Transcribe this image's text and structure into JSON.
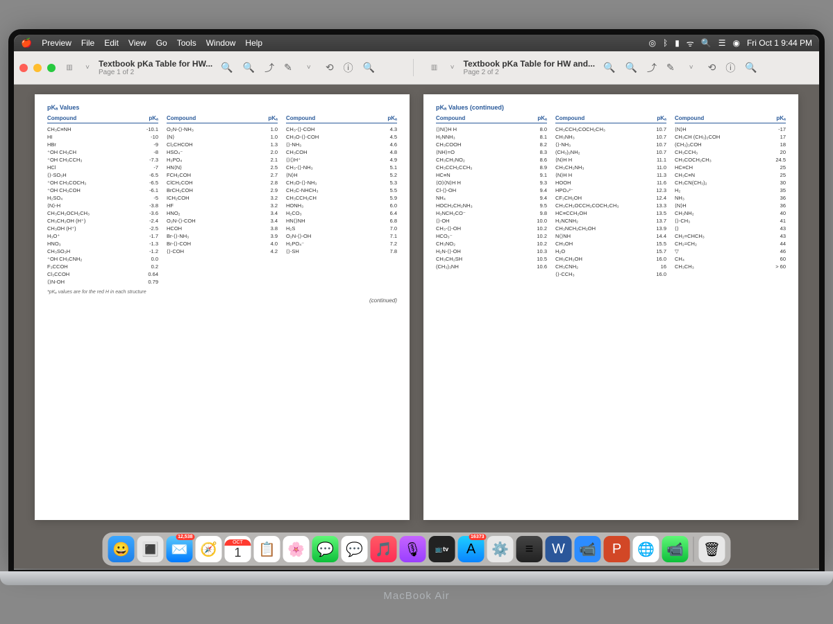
{
  "menubar": {
    "app": "Preview",
    "items": [
      "File",
      "Edit",
      "View",
      "Go",
      "Tools",
      "Window",
      "Help"
    ],
    "clock": "Fri Oct 1 9:44 PM"
  },
  "window": {
    "tabs": [
      {
        "title": "Textbook pKa Table for HW...",
        "subtitle": "Page 1 of 2"
      },
      {
        "title": "Textbook pKa Table for HW and...",
        "subtitle": "Page 2 of 2"
      }
    ]
  },
  "page1": {
    "header": "pKₐ Values",
    "col_hdr": [
      "Compound",
      "pKₐ"
    ],
    "footnote": "*pKₐ values are for the red H in each structure",
    "continued": "(continued)",
    "cols": [
      [
        {
          "c": "CH₃C≡NH",
          "p": "-10.1"
        },
        {
          "c": "HI",
          "p": "-10"
        },
        {
          "c": "HBr",
          "p": "-9"
        },
        {
          "c": "⁺OH CH₃CH",
          "p": "-8"
        },
        {
          "c": "⁺OH CH₃CCH₃",
          "p": "-7.3"
        },
        {
          "c": "HCl",
          "p": "-7"
        },
        {
          "c": "⟨⟩-SO₃H",
          "p": "-6.5"
        },
        {
          "c": "⁺OH CH₃COCH₃",
          "p": "-6.5"
        },
        {
          "c": "⁺OH CH₃COH",
          "p": "-6.1"
        },
        {
          "c": "H₂SO₄",
          "p": "-5"
        },
        {
          "c": "⟨N⟩-H",
          "p": "-3.8"
        },
        {
          "c": "CH₃CH₂OCH₂CH₃",
          "p": "-3.6"
        },
        {
          "c": "CH₃CH₂OH (H⁺)",
          "p": "-2.4"
        },
        {
          "c": "CH₃OH (H⁺)",
          "p": "-2.5"
        },
        {
          "c": "H₃O⁺",
          "p": "-1.7"
        },
        {
          "c": "HNO₃",
          "p": "-1.3"
        },
        {
          "c": "CH₃SO₃H",
          "p": "-1.2"
        },
        {
          "c": "⁺OH CH₃CNH₂",
          "p": "0.0"
        },
        {
          "c": "F₃CCOH",
          "p": "0.2"
        },
        {
          "c": "Cl₃CCOH",
          "p": "0.64"
        },
        {
          "c": "⟨⟩N-OH",
          "p": "0.79"
        }
      ],
      [
        {
          "c": "O₂N-⟨⟩-NH₃",
          "p": "1.0"
        },
        {
          "c": "⟨N⟩",
          "p": "1.0"
        },
        {
          "c": "Cl₂CHCOH",
          "p": "1.3"
        },
        {
          "c": "HSO₄⁻",
          "p": "2.0"
        },
        {
          "c": "H₃PO₄",
          "p": "2.1"
        },
        {
          "c": "HN⟨N⟩",
          "p": "2.5"
        },
        {
          "c": "FCH₂COH",
          "p": "2.7"
        },
        {
          "c": "ClCH₂COH",
          "p": "2.8"
        },
        {
          "c": "BrCH₂COH",
          "p": "2.9"
        },
        {
          "c": "ICH₂COH",
          "p": "3.2"
        },
        {
          "c": "HF",
          "p": "3.2"
        },
        {
          "c": "HNO₂",
          "p": "3.4"
        },
        {
          "c": "O₂N-⟨⟩-COH",
          "p": "3.4"
        },
        {
          "c": "HCOH",
          "p": "3.8"
        },
        {
          "c": "Br-⟨⟩-NH₃",
          "p": "3.9"
        },
        {
          "c": "Br-⟨⟩-COH",
          "p": "4.0"
        },
        {
          "c": "⟨⟩-COH",
          "p": "4.2"
        }
      ],
      [
        {
          "c": "CH₃-⟨⟩-COH",
          "p": "4.3"
        },
        {
          "c": "CH₃O-⟨⟩-COH",
          "p": "4.5"
        },
        {
          "c": "⟨⟩-NH₃",
          "p": "4.6"
        },
        {
          "c": "CH₃COH",
          "p": "4.8"
        },
        {
          "c": "⟨⟩⟨⟩H⁺",
          "p": "4.9"
        },
        {
          "c": "CH₃-⟨⟩-NH₃",
          "p": "5.1"
        },
        {
          "c": "⟨N⟩H",
          "p": "5.2"
        },
        {
          "c": "CH₃O-⟨⟩-NH₃",
          "p": "5.3"
        },
        {
          "c": "CH₃C-NHCH₃",
          "p": "5.5"
        },
        {
          "c": "CH₃CCH₂CH",
          "p": "5.9"
        },
        {
          "c": "HONH₃",
          "p": "6.0"
        },
        {
          "c": "H₂CO₃",
          "p": "6.4"
        },
        {
          "c": "HN⟨⟩NH",
          "p": "6.8"
        },
        {
          "c": "H₂S",
          "p": "7.0"
        },
        {
          "c": "O₂N-⟨⟩-OH",
          "p": "7.1"
        },
        {
          "c": "H₂PO₄⁻",
          "p": "7.2"
        },
        {
          "c": "⟨⟩-SH",
          "p": "7.8"
        }
      ]
    ]
  },
  "page2": {
    "header": "pKₐ Values (continued)",
    "col_hdr": [
      "Compound",
      "pKₐ"
    ],
    "cols": [
      [
        {
          "c": "⟨⟩N⟨⟩H H",
          "p": "8.0"
        },
        {
          "c": "H₂NNH₃",
          "p": "8.1"
        },
        {
          "c": "CH₃COOH",
          "p": "8.2"
        },
        {
          "c": "⟨NH⟩=O",
          "p": "8.3"
        },
        {
          "c": "CH₃CH₂NO₂",
          "p": "8.6"
        },
        {
          "c": "CH₃CCH₂CCH₃",
          "p": "8.9"
        },
        {
          "c": "HC≡N",
          "p": "9.1"
        },
        {
          "c": "⟨O⟩⟨N⟩H H",
          "p": "9.3"
        },
        {
          "c": "Cl-⟨⟩-OH",
          "p": "9.4"
        },
        {
          "c": "NH₄",
          "p": "9.4"
        },
        {
          "c": "HOCH₂CH₂NH₃",
          "p": "9.5"
        },
        {
          "c": "H₃NCH₂CO⁻",
          "p": "9.8"
        },
        {
          "c": "⟨⟩-OH",
          "p": "10.0"
        },
        {
          "c": "CH₃-⟨⟩-OH",
          "p": "10.2"
        },
        {
          "c": "HCO₃⁻",
          "p": "10.2"
        },
        {
          "c": "CH₃NO₂",
          "p": "10.2"
        },
        {
          "c": "H₂N-⟨⟩-OH",
          "p": "10.3"
        },
        {
          "c": "CH₃CH₂SH",
          "p": "10.5"
        },
        {
          "c": "(CH₃)₃NH",
          "p": "10.6"
        }
      ],
      [
        {
          "c": "CH₃CCH₂COCH₂CH₃",
          "p": "10.7"
        },
        {
          "c": "CH₃NH₃",
          "p": "10.7"
        },
        {
          "c": "⟨⟩-NH₃",
          "p": "10.7"
        },
        {
          "c": "(CH₃)₂NH₂",
          "p": "10.7"
        },
        {
          "c": "⟨N⟩H H",
          "p": "11.1"
        },
        {
          "c": "CH₃CH₂NH₃",
          "p": "11.0"
        },
        {
          "c": "⟨N⟩H H",
          "p": "11.3"
        },
        {
          "c": "HOOH",
          "p": "11.6"
        },
        {
          "c": "HPO₄²⁻",
          "p": "12.3"
        },
        {
          "c": "CF₃CH₂OH",
          "p": "12.4"
        },
        {
          "c": "CH₃CH₂OCCH₂COCH₂CH₃",
          "p": "13.3"
        },
        {
          "c": "HC≡CCH₂OH",
          "p": "13.5"
        },
        {
          "c": "H₂NCNH₂",
          "p": "13.7"
        },
        {
          "c": "CH₃NCH₂CH₂OH",
          "p": "13.9"
        },
        {
          "c": "N⟨⟩NH",
          "p": "14.4"
        },
        {
          "c": "CH₃OH",
          "p": "15.5"
        },
        {
          "c": "H₂O",
          "p": "15.7"
        },
        {
          "c": "CH₃CH₂OH",
          "p": "16.0"
        },
        {
          "c": "CH₃CNH₂",
          "p": "16"
        },
        {
          "c": "⟨⟩-CCH₃",
          "p": "16.0"
        }
      ],
      [
        {
          "c": "⟨N⟩H",
          "p": "-17"
        },
        {
          "c": "CH₃CH (CH₃)₂COH",
          "p": "17"
        },
        {
          "c": "(CH₃)₃COH",
          "p": "18"
        },
        {
          "c": "CH₃CCH₃",
          "p": "20"
        },
        {
          "c": "CH₃COCH₂CH₃",
          "p": "24.5"
        },
        {
          "c": "HC≡CH",
          "p": "25"
        },
        {
          "c": "CH₃C≡N",
          "p": "25"
        },
        {
          "c": "CH₃CN(CH₃)₂",
          "p": "30"
        },
        {
          "c": "H₂",
          "p": "35"
        },
        {
          "c": "NH₃",
          "p": "36"
        },
        {
          "c": "⟨N⟩H",
          "p": "36"
        },
        {
          "c": "CH₃NH₂",
          "p": "40"
        },
        {
          "c": "⟨⟩-CH₃",
          "p": "41"
        },
        {
          "c": "⟨⟩",
          "p": "43"
        },
        {
          "c": "CH₂=CHCH₃",
          "p": "43"
        },
        {
          "c": "CH₂=CH₂",
          "p": "44"
        },
        {
          "c": "▽",
          "p": "46"
        },
        {
          "c": "CH₄",
          "p": "60"
        },
        {
          "c": "CH₃CH₃",
          "p": "> 60"
        }
      ]
    ]
  },
  "dock": {
    "mail_badge": "12,538",
    "cal_month": "OCT",
    "cal_day": "1",
    "appstore_badge": "16373",
    "tv_label": "A",
    "apps": [
      "Finder",
      "Launchpad",
      "Mail",
      "Safari",
      "Calendar",
      "Reminders",
      "Photos",
      "Messages",
      "Messenger",
      "Music",
      "Podcasts",
      "Apple TV",
      "App Store",
      "System Preferences",
      "Spotify",
      "Word",
      "Zoom",
      "PowerPoint",
      "Chrome",
      "FaceTime",
      "Trash"
    ]
  },
  "laptop": "MacBook Air"
}
